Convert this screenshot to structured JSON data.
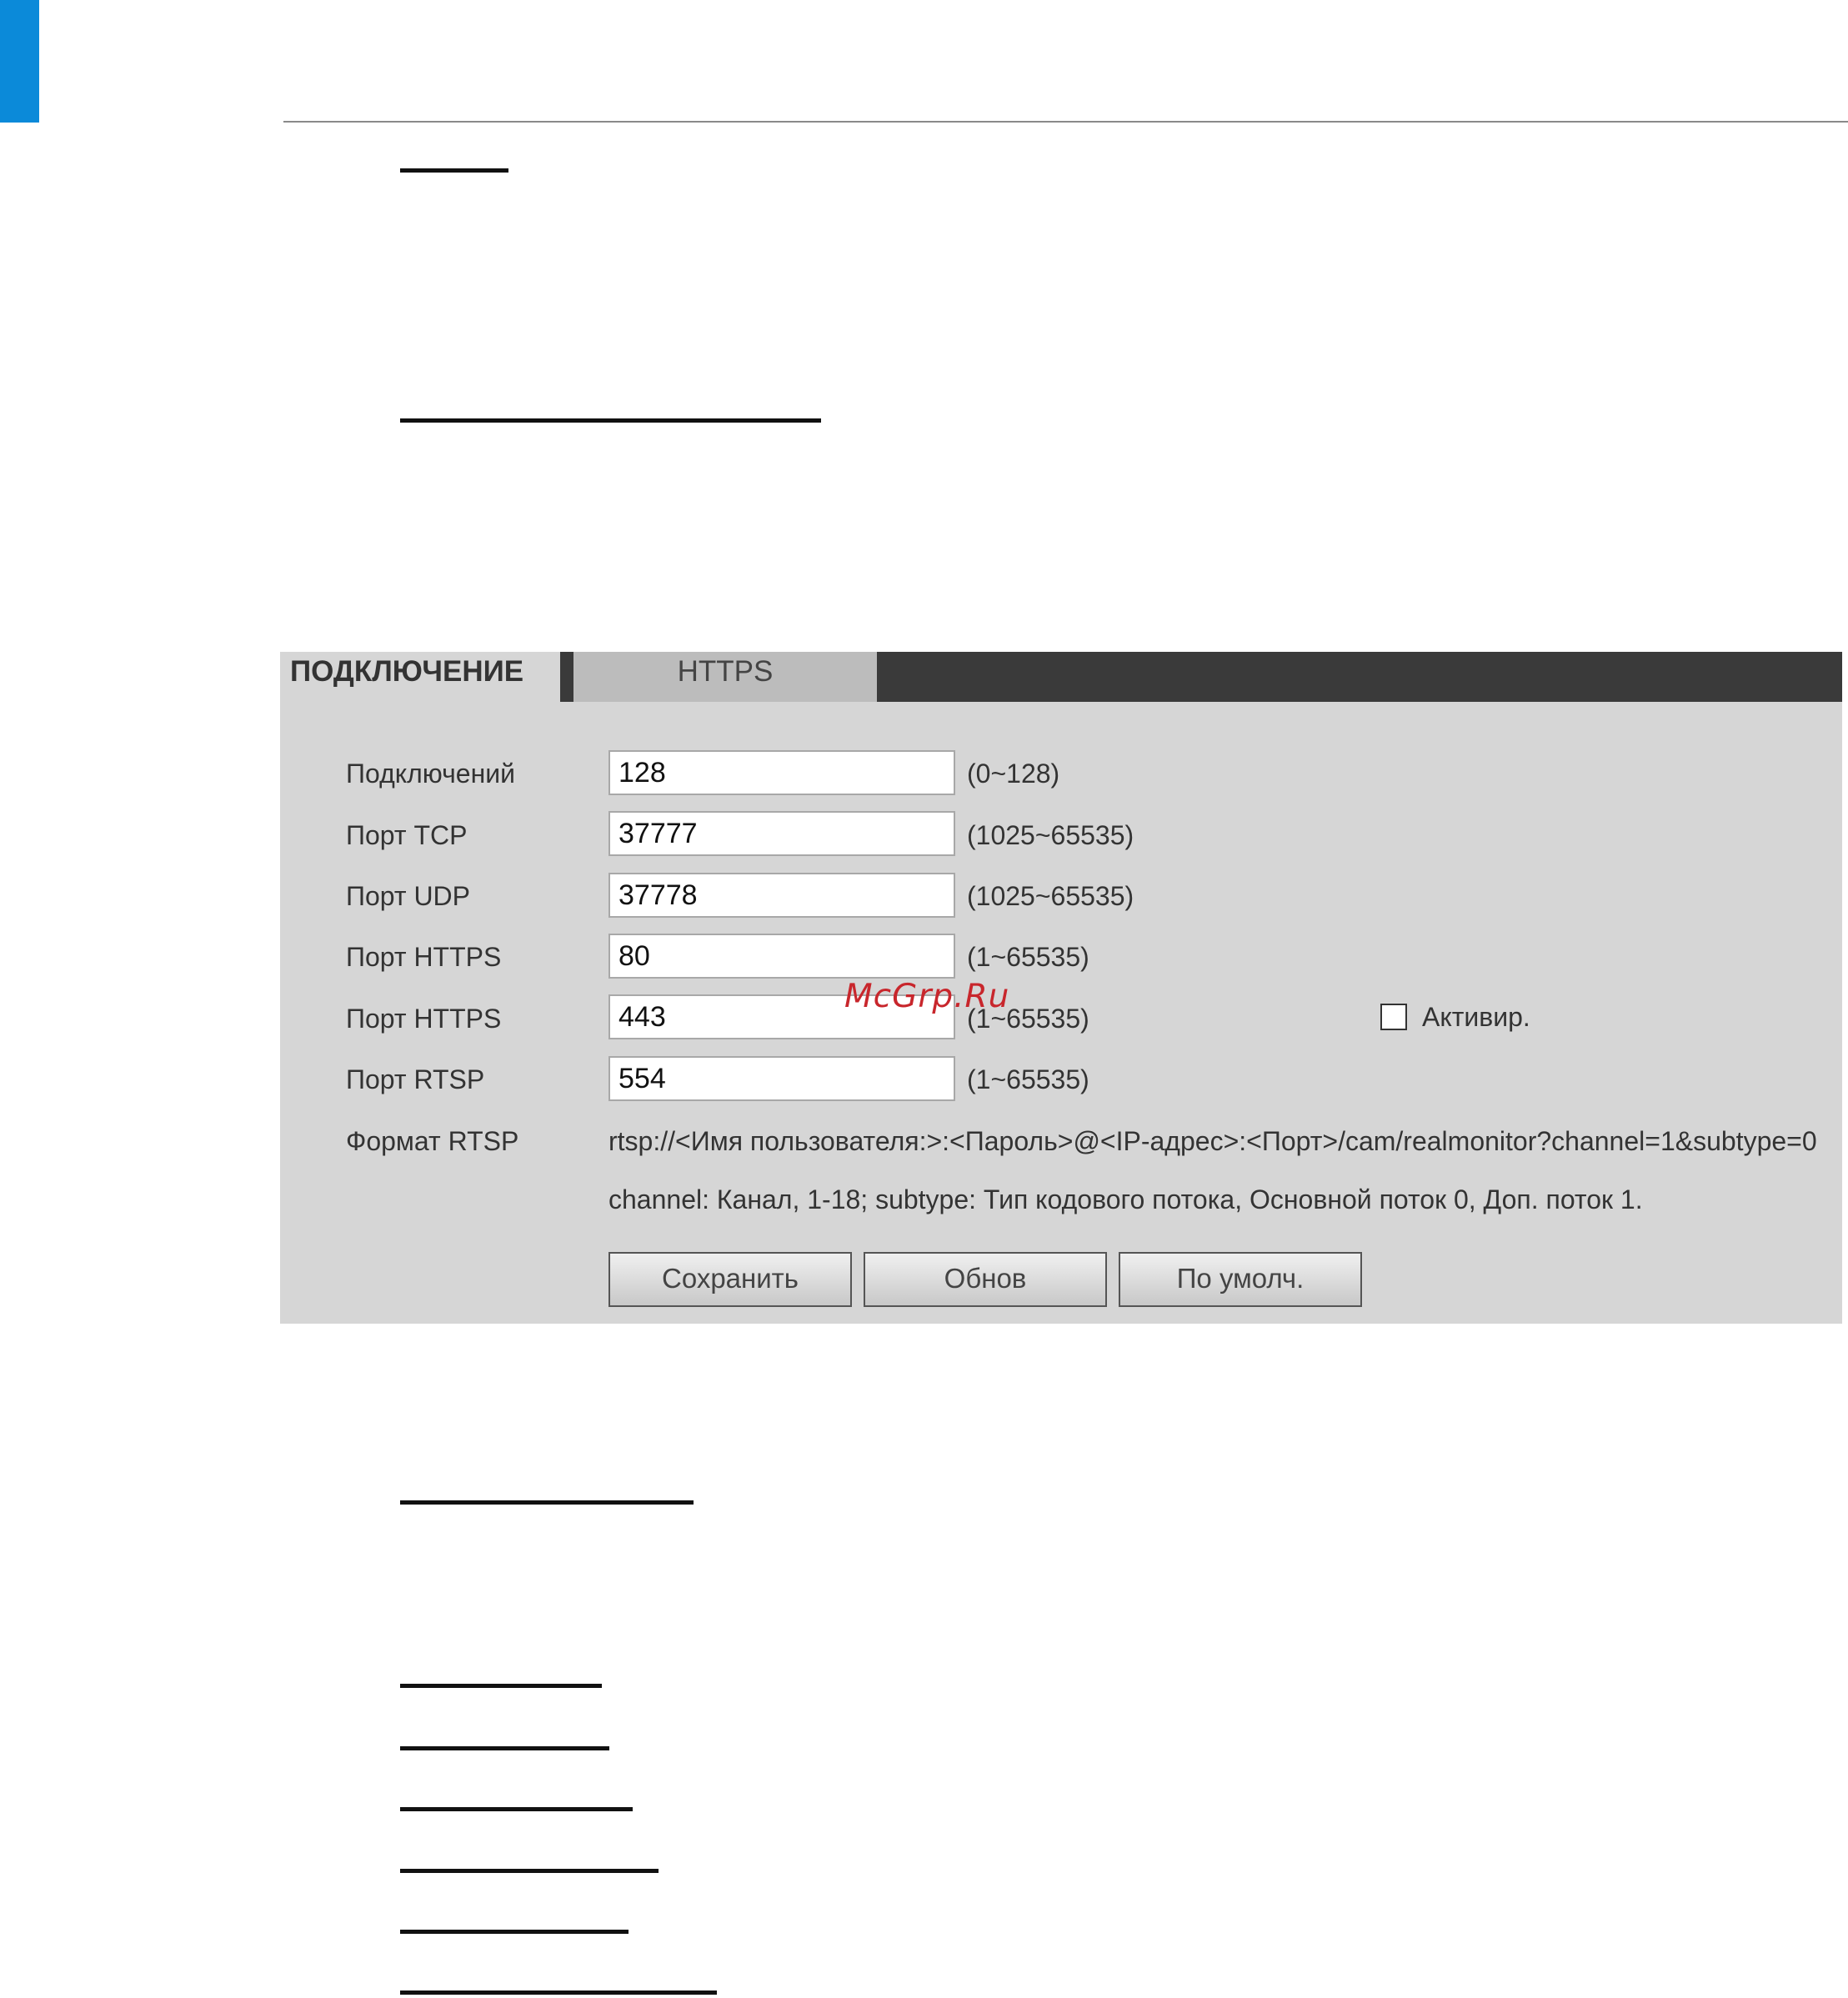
{
  "panel": {
    "tabs": [
      {
        "label": "ПОДКЛЮЧЕНИЕ",
        "active": true
      },
      {
        "label": "HTTPS",
        "active": false
      }
    ],
    "rows": [
      {
        "label": "Подключений",
        "value": "128",
        "range": "(0~128)"
      },
      {
        "label": "Порт TCP",
        "value": "37777",
        "range": "(1025~65535)"
      },
      {
        "label": "Порт UDP",
        "value": "37778",
        "range": "(1025~65535)"
      },
      {
        "label": "Порт HTTPS",
        "value": "80",
        "range": "(1~65535)"
      },
      {
        "label": "Порт HTTPS",
        "value": "443",
        "range": "(1~65535)"
      },
      {
        "label": "Порт RTSP",
        "value": "554",
        "range": "(1~65535)"
      }
    ],
    "https_enable_label": "Активир.",
    "https_enable_checked": false,
    "rtsp_format_label": "Формат RTSP",
    "rtsp_format": "rtsp://<Имя пользователя:>:<Пароль>@<IP-адрес>:<Порт>/cam/realmonitor?channel=1&subtype=0",
    "rtsp_note": "channel: Канал, 1-18; subtype: Тип кодового потока, Основной поток 0, Доп. поток 1.",
    "buttons": {
      "save": "Сохранить",
      "refresh": "Обнов",
      "default": "По умолч."
    }
  },
  "watermark": "McGrp.Ru",
  "colors": {
    "accent": "#0b8ad9",
    "panel_bg": "#d6d6d6",
    "tabbar_bg": "#3a3a3a",
    "watermark": "#c8262c"
  }
}
